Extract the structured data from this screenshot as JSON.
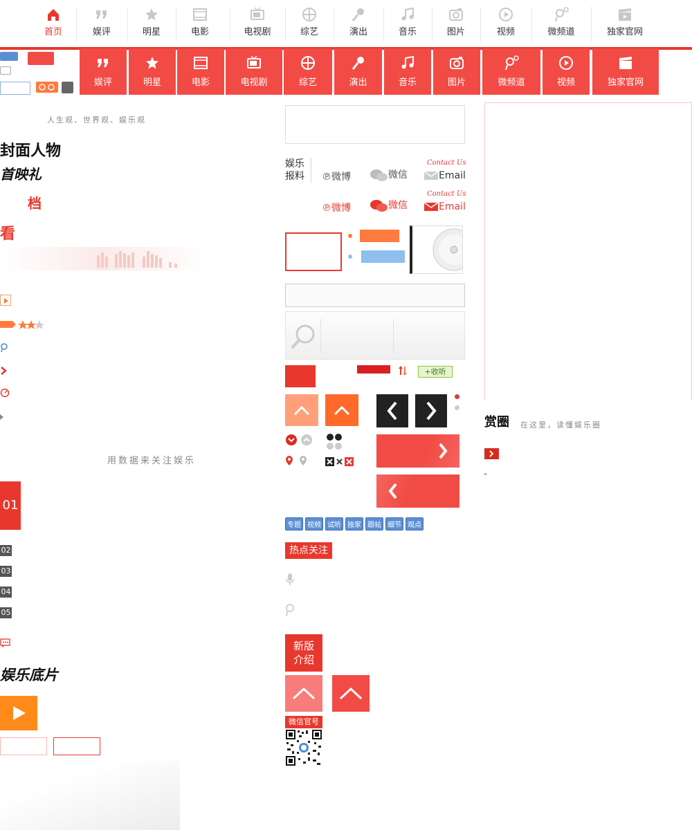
{
  "top_nav": {
    "items": [
      {
        "label": "首页",
        "icon": "home-icon",
        "active": true
      },
      {
        "label": "娱评",
        "icon": "quote-icon"
      },
      {
        "label": "明星",
        "icon": "star-icon"
      },
      {
        "label": "电影",
        "icon": "film-icon"
      },
      {
        "label": "电视剧",
        "icon": "tv-icon"
      },
      {
        "label": "综艺",
        "icon": "aperture-icon"
      },
      {
        "label": "演出",
        "icon": "microphone-icon"
      },
      {
        "label": "音乐",
        "icon": "music-note-icon"
      },
      {
        "label": "图片",
        "icon": "camera-icon"
      },
      {
        "label": "视频",
        "icon": "play-circle-icon"
      },
      {
        "label": "微频道",
        "icon": "weibo-channel-icon"
      },
      {
        "label": "独家官网",
        "icon": "clapperboard-icon"
      }
    ]
  },
  "red_nav": {
    "items": [
      {
        "label": "娱评",
        "icon": "quote-icon"
      },
      {
        "label": "明星",
        "icon": "star-icon"
      },
      {
        "label": "电影",
        "icon": "film-icon"
      },
      {
        "label": "电视剧",
        "icon": "tv-icon"
      },
      {
        "label": "综艺",
        "icon": "aperture-icon"
      },
      {
        "label": "演出",
        "icon": "microphone-icon"
      },
      {
        "label": "音乐",
        "icon": "music-note-icon"
      },
      {
        "label": "图片",
        "icon": "camera-icon"
      },
      {
        "label": "微频道",
        "icon": "weibo-channel-icon"
      },
      {
        "label": "视频",
        "icon": "play-circle-icon"
      },
      {
        "label": "独家官网",
        "icon": "clapperboard-icon"
      }
    ]
  },
  "left": {
    "slogan": "人生观、世界观、娱乐观",
    "cover_people": "封面人物",
    "premiere": "首映礼",
    "dang": "档",
    "kan": "看",
    "data_slogan": "用数据来关注娱乐",
    "rank": [
      "01",
      "02",
      "03",
      "04",
      "05"
    ],
    "yule_dipian": "娱乐底片"
  },
  "middle": {
    "report_label": "娱乐报料",
    "contact_us": "Contact Us",
    "weibo": "微博",
    "weixin": "微信",
    "email": "Email",
    "listen": "收听",
    "tags": [
      "专题",
      "视频",
      "试听",
      "独家",
      "跟帖",
      "细节",
      "观点"
    ],
    "hot_label": "热点关注",
    "new_intro": "新版介绍",
    "wechat_official": "微信官号"
  },
  "right": {
    "yule_quan": "赏圈",
    "yule_quan_slogan": "在这里，读懂娱乐圈"
  },
  "colors": {
    "brand_red": "#e8382d",
    "nav_red": "#f24b45",
    "orange": "#ff7a3d",
    "blue_tag": "#5b8fd3",
    "light_blue": "#8fbfee",
    "green": "#8fc33d"
  }
}
